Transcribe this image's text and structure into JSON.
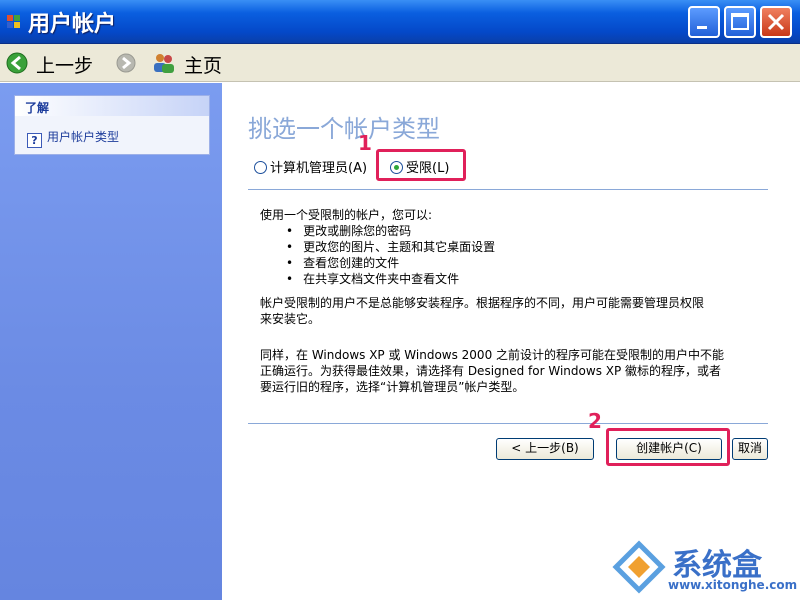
{
  "window": {
    "title": "用户帐户",
    "title_color": "#0a5fe0"
  },
  "nav": {
    "back_label": "上一步",
    "home_label": "主页"
  },
  "sidebar": {
    "panel_title": "了解",
    "items": [
      {
        "label": "用户帐户类型",
        "icon": "help-icon"
      }
    ]
  },
  "main": {
    "title": "挑选一个帐户类型",
    "radio_options": [
      {
        "label": "计算机管理员",
        "accel": "(A)",
        "checked": false
      },
      {
        "label": "受限",
        "accel": "(L)",
        "checked": true
      }
    ],
    "intro": "使用一个受限制的帐户，您可以:",
    "bullets": [
      "更改或删除您的密码",
      "更改您的图片、主题和其它桌面设置",
      "查看您创建的文件",
      "在共享文档文件夹中查看文件"
    ],
    "paragraph1_line1": "帐户受限制的用户不是总能够安装程序。根据程序的不同，用户可能需要管理员权限",
    "paragraph1_line2": "来安装它。",
    "paragraph2_line1": "同样，在 Windows XP 或 Windows 2000 之前设计的程序可能在受限制的用户中不能",
    "paragraph2_line2": "正确运行。为获得最佳效果，请选择有 Designed for Windows XP 徽标的程序，或者",
    "paragraph2_line3": "要运行旧的程序，选择“计算机管理员”帐户类型。",
    "buttons": {
      "back": "< 上一步(B)",
      "create": "创建帐户(C)",
      "cancel": "取消"
    }
  },
  "annotations": {
    "step1": "1",
    "step2": "2",
    "highlight_color": "#e0205a"
  },
  "watermark": {
    "text": "系统盒",
    "url": "www.xitonghe.com"
  }
}
